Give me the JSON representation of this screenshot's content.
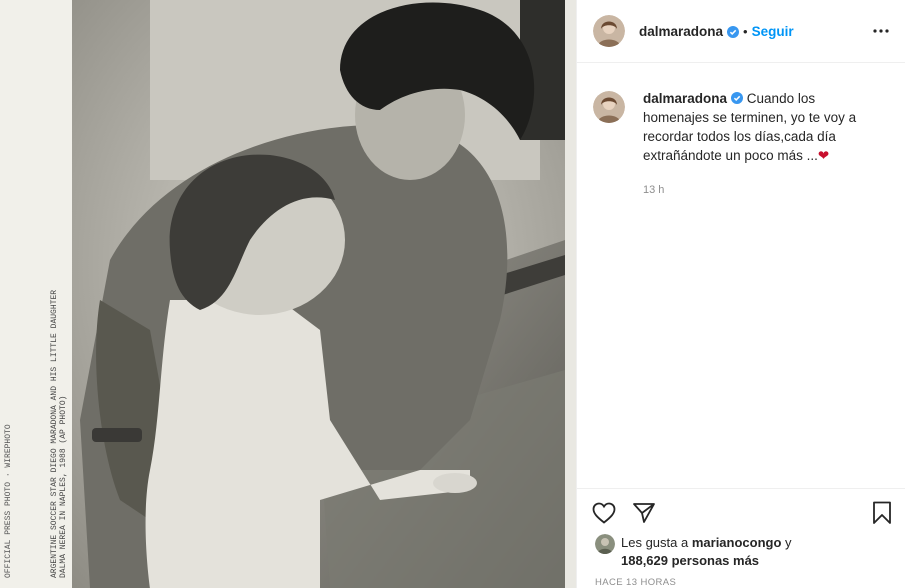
{
  "post": {
    "author": "dalmaradona",
    "dot": "•",
    "follow_label": "Seguir",
    "more_icon": "more-horizontal-icon",
    "caption_text": "Cuando los homenajes se terminen, yo te voy a recordar todos los días,cada día extrañándote un poco más ...",
    "caption_emoji": "❤",
    "time_short": "13 h",
    "likes_prefix": "Les gusta a",
    "likes_user": "marianocongo",
    "likes_conj": "y",
    "likes_count": "188,629 personas más",
    "time_long": "HACE 13 HORAS",
    "photo_caption_lines": [
      "ARGENTINE SOCCER STAR DIEGO MARADONA AND HIS LITTLE DAUGHTER",
      "DALMA NEREA IN NAPLES, 1988 (AP PHOTO)",
      "OFFICIAL PRESS PHOTO  ·  WIREPHOTO"
    ]
  },
  "colors": {
    "accent": "#0095f6",
    "verified": "#3897f0",
    "heart": "#c8102e",
    "secondary_text": "#8e8e8e"
  },
  "icons": {
    "like": "heart-outline-icon",
    "share": "paper-plane-icon",
    "save": "bookmark-icon",
    "verified": "verified-badge-icon"
  }
}
